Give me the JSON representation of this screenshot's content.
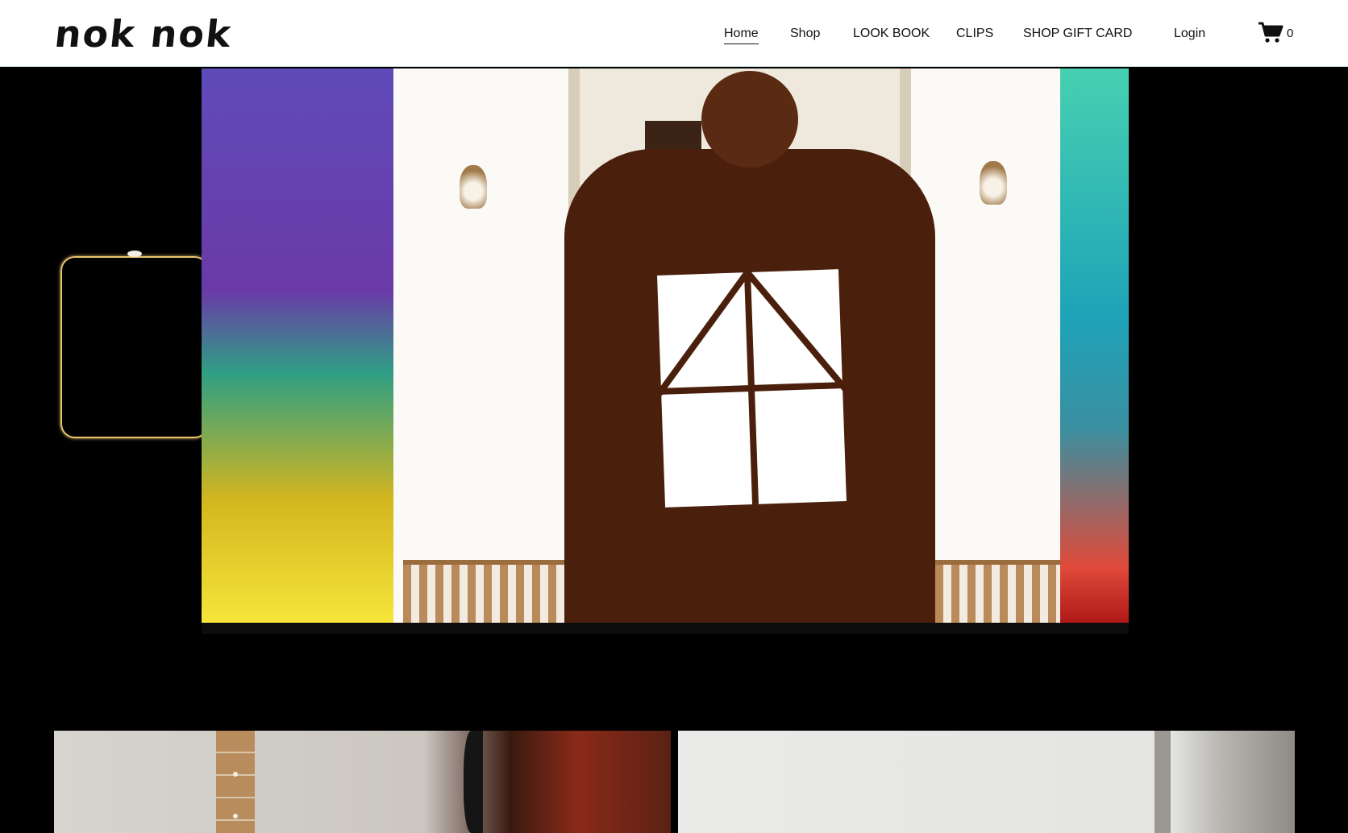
{
  "header": {
    "logo_text": "nok nok",
    "nav": [
      {
        "label": "Home",
        "active": true
      },
      {
        "label": "Shop",
        "active": false
      },
      {
        "label": "LOOK BOOK",
        "active": false
      },
      {
        "label": "CLIPS",
        "active": false
      },
      {
        "label": "SHOP GIFT CARD",
        "active": false
      }
    ],
    "login_label": "Login",
    "cart": {
      "icon": "cart-icon",
      "count": "0"
    }
  },
  "hero": {
    "media": "video-frame",
    "frame_color": "#e9c56a"
  },
  "tiles": [
    {
      "name": "product-tile-guitar"
    },
    {
      "name": "product-tile-turntable"
    }
  ]
}
